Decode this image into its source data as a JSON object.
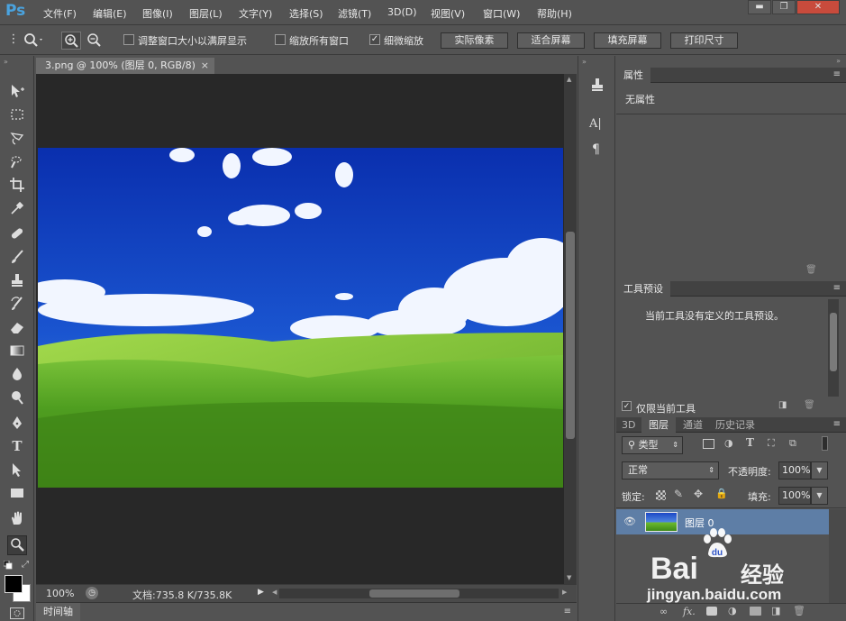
{
  "app": {
    "logo": "Ps"
  },
  "menu": [
    "文件(F)",
    "编辑(E)",
    "图像(I)",
    "图层(L)",
    "文字(Y)",
    "选择(S)",
    "滤镜(T)",
    "3D(D)",
    "视图(V)",
    "窗口(W)",
    "帮助(H)"
  ],
  "window_controls": {
    "minimize": "▬",
    "restore": "❐",
    "close": "✕"
  },
  "options": {
    "resize_windows": {
      "label": "调整窗口大小以满屏显示",
      "checked": ""
    },
    "zoom_all": {
      "label": "缩放所有窗口",
      "checked": ""
    },
    "scrubby": {
      "label": "细微缩放",
      "checked": "✓"
    },
    "btn_actual": "实际像素",
    "btn_fit": "适合屏幕",
    "btn_fill": "填充屏幕",
    "btn_print": "打印尺寸"
  },
  "document": {
    "tab_title": "3.png @ 100% (图层 0, RGB/8)",
    "close": "×"
  },
  "status": {
    "zoom": "100%",
    "doc_info": "文档:735.8 K/735.8K"
  },
  "timeline": {
    "label": "时间轴"
  },
  "properties": {
    "tab": "属性",
    "empty_text": "无属性"
  },
  "tool_presets": {
    "tab": "工具预设",
    "empty_text": "当前工具没有定义的工具预设。",
    "current_only": "仅限当前工具",
    "current_only_checked": "✓"
  },
  "layers_panel": {
    "tabs": [
      "3D",
      "图层",
      "通道",
      "历史记录"
    ],
    "filter_kind": "类型",
    "blend_mode": "正常",
    "opacity_label": "不透明度:",
    "opacity_value": "100%",
    "lock_label": "锁定:",
    "fill_label": "填充:",
    "fill_value": "100%",
    "layer_name": "图层 0",
    "footer_icons": [
      "link-icon",
      "fx-icon",
      "mask-icon",
      "adjustment-icon",
      "folder-icon",
      "new-layer-icon",
      "trash-icon"
    ],
    "footer_fx": "fx."
  },
  "watermark": {
    "brand": "Bai",
    "brand_zh": "经验",
    "url": "jingyan.baidu.com"
  },
  "colors": {
    "bg": "#535353",
    "dark": "#282828",
    "selection": "#5e7ea6",
    "accent": "#4aa3df"
  }
}
